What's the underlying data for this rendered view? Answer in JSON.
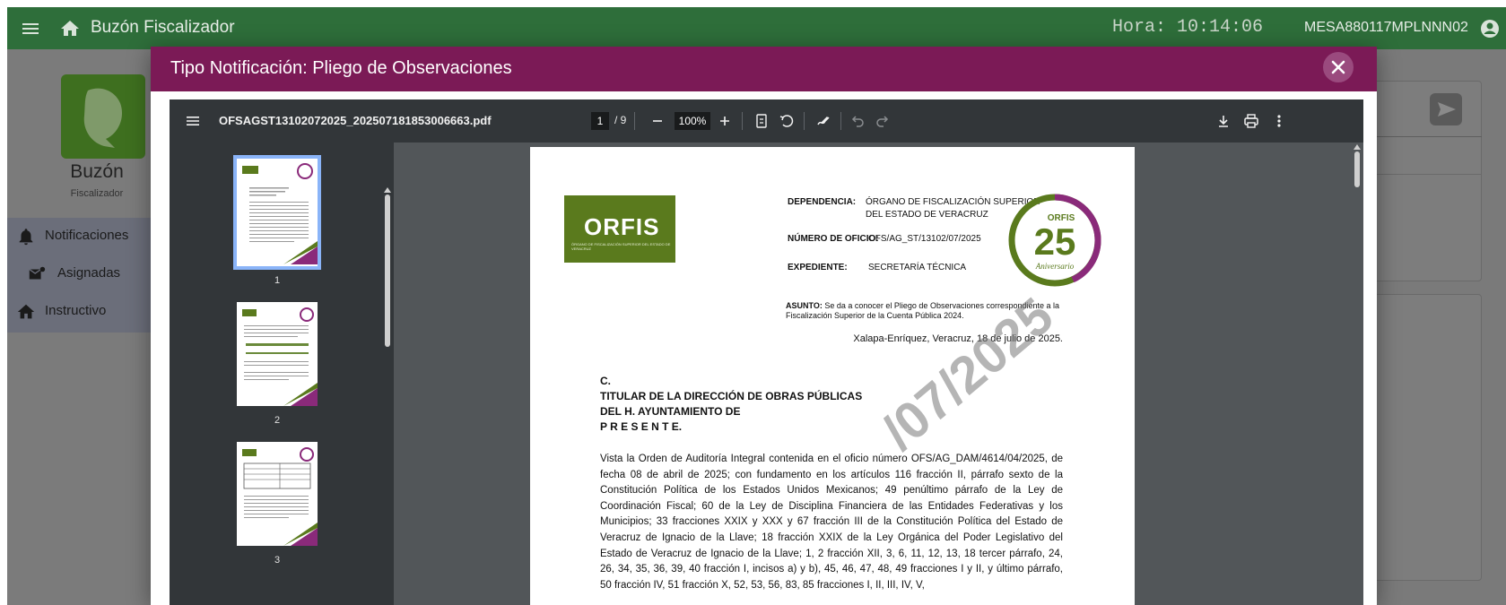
{
  "appbar": {
    "title": "Buzón Fiscalizador",
    "clock": "Hora: 10:14:06",
    "user": "MESA880117MPLNNN02"
  },
  "sidebar": {
    "brand": "Buzón",
    "brand_sub": "Fiscalizador",
    "items": [
      {
        "label": "Notificaciones",
        "icon": "bell-icon"
      },
      {
        "label": "Asignadas",
        "icon": "mail-assigned-icon"
      },
      {
        "label": "Instructivo",
        "icon": "home-icon"
      }
    ]
  },
  "modal": {
    "title": "Tipo Notificación: Pliego de Observaciones"
  },
  "viewer": {
    "filename": "OFSAGST13102072025_20250718185300666​3.pdf",
    "page_current": "1",
    "page_total": "/ 9",
    "zoom": "100%",
    "thumbnails": [
      "1",
      "2",
      "3"
    ]
  },
  "document": {
    "logo_text": "ORFIS",
    "logo_sub": "ÓRGANO DE FISCALIZACIÓN SUPERIOR DEL ESTADO DE VERACRUZ",
    "dependencia_label": "DEPENDENCIA:",
    "dependencia_value_1": "ÓRGANO DE FISCALIZACIÓN SUPERIOR",
    "dependencia_value_2": "DEL ESTADO DE VERACRUZ",
    "oficio_label": "NÚMERO DE OFICIO:",
    "oficio_value": "OFS/AG_ST/13102/07/2025",
    "expediente_label": "EXPEDIENTE:",
    "expediente_value": "SECRETARÍA TÉCNICA",
    "seal_number": "25",
    "seal_word": "Aniversario",
    "asunto_label": "ASUNTO:",
    "asunto_text": "Se da a conocer el Pliego de Observaciones correspondiente a la Fiscalización Superior de la Cuenta Pública 2024.",
    "date": "Xalapa-Enríquez, Veracruz, 18 de julio de 2025.",
    "addressee_1": "C.",
    "addressee_2": "TITULAR DE LA DIRECCIÓN DE OBRAS PÚBLICAS",
    "addressee_3": "DEL H. AYUNTAMIENTO DE",
    "addressee_4": "P R E S E N T E.",
    "body": "Vista la Orden de Auditoría Integral contenida en el oficio número OFS/AG_DAM/4614/04/2025, de fecha 08 de abril de 2025; con fundamento en los artículos 116 fracción II, párrafo sexto de la Constitución Política de los Estados Unidos Mexicanos; 49 penúltimo párrafo de la Ley de Coordinación Fiscal; 60 de la Ley de Disciplina Financiera de las Entidades Federativas y los Municipios; 33 fracciones XXIX y XXX y 67 fracción III de la Constitución Política del Estado de Veracruz de Ignacio de la Llave; 18 fracción XXIX de la Ley Orgánica del Poder Legislativo del Estado de Veracruz de Ignacio de la Llave; 1, 2 fracción XII, 3, 6, 11, 12, 13, 18 tercer párrafo, 24, 26, 34, 35, 36, 39, 40 fracción I, incisos a) y b), 45, 46, 47, 48, 49 fracciones I y II, y último párrafo, 50 fracción IV, 51 fracción X, 52, 53, 56, 83, 85 fracciones I, II, III, IV, V,",
    "watermark": "/07/2025"
  },
  "colors": {
    "appbar": "#2e6e3a",
    "modal_header": "#7b1a56",
    "logo_green": "#5a7a1d",
    "seal_purple": "#8a2a7a"
  }
}
